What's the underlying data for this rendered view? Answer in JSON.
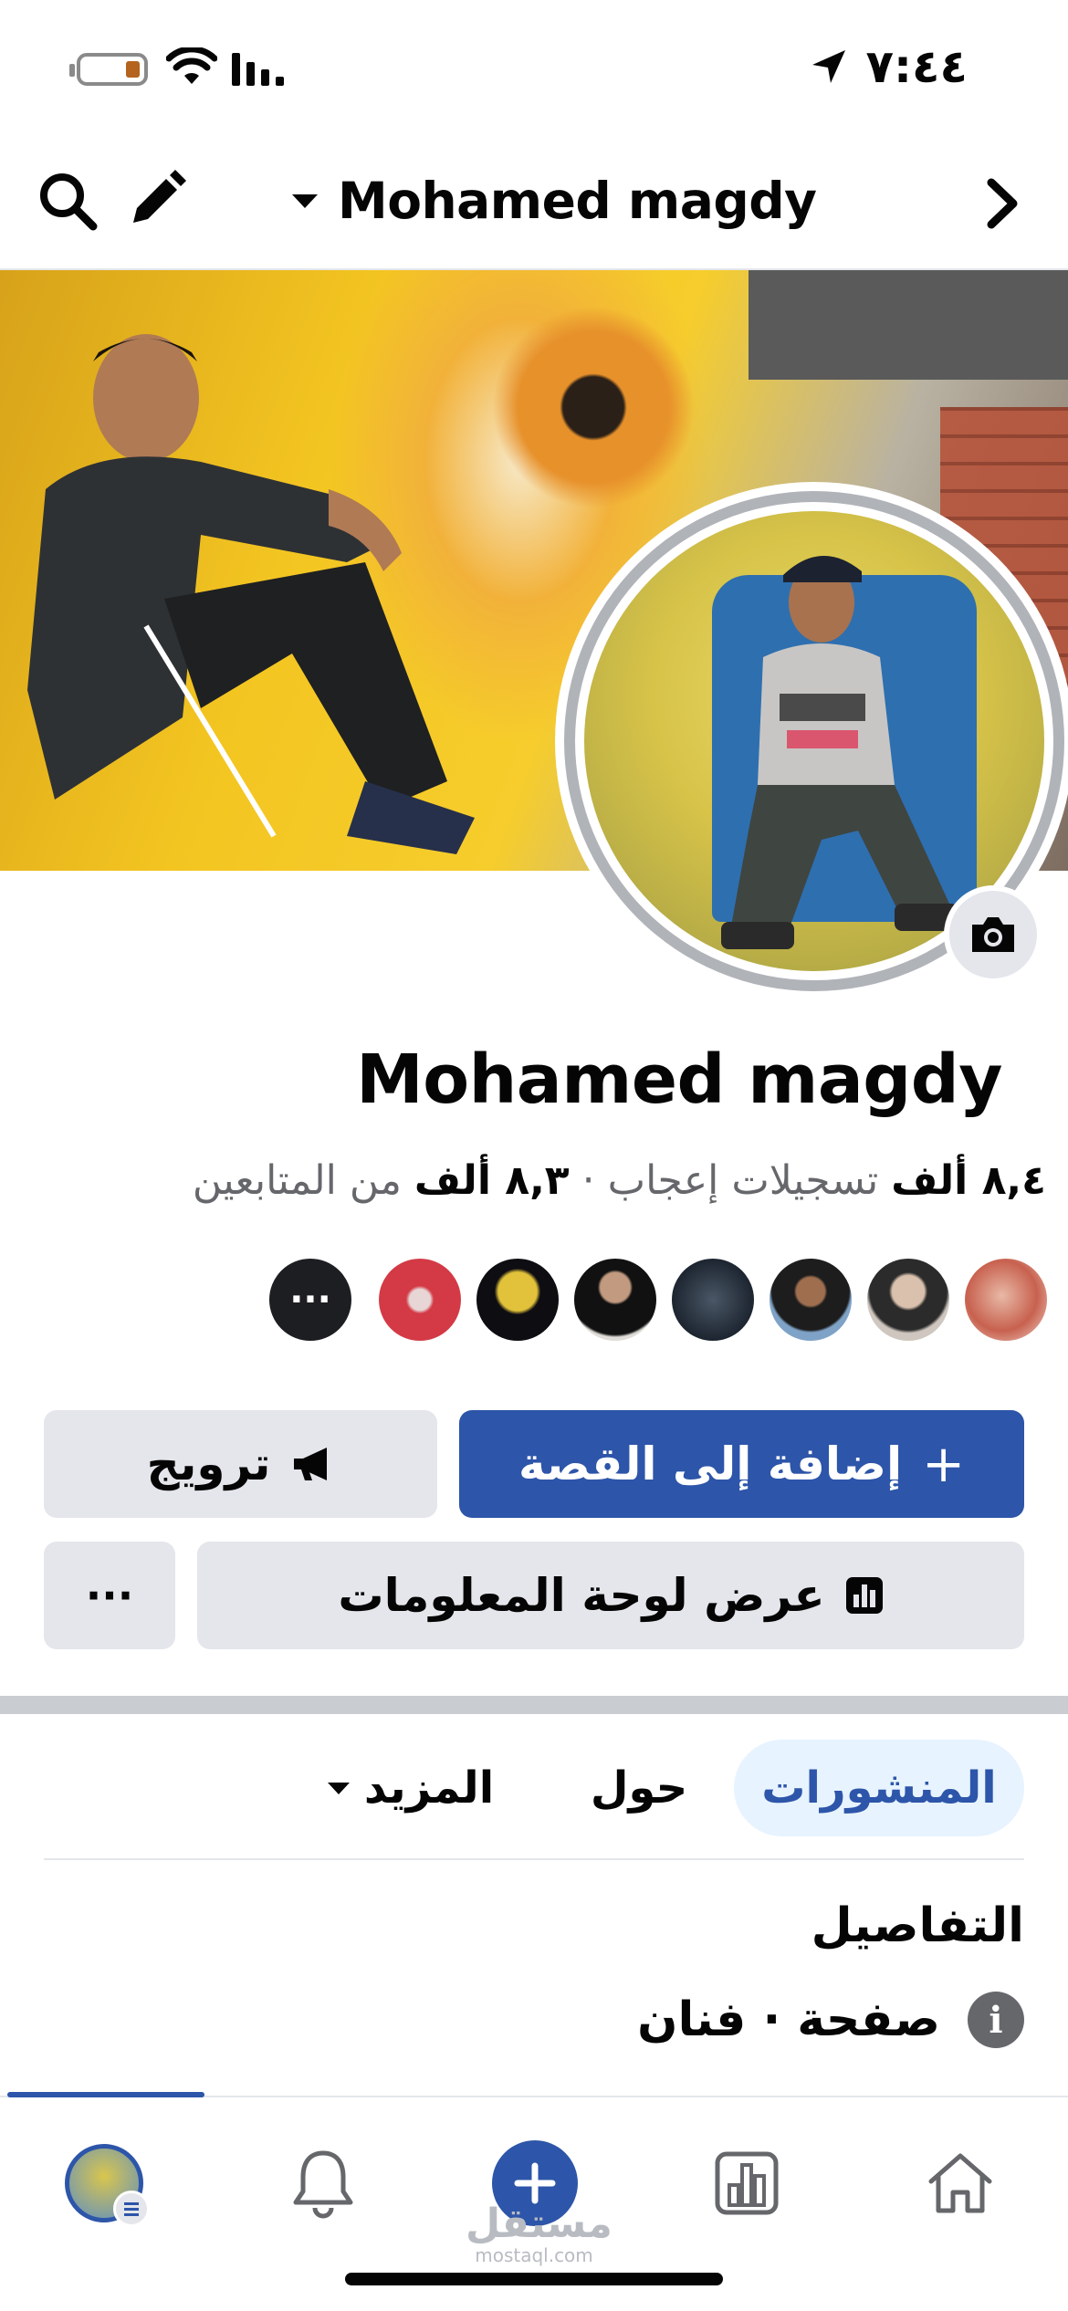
{
  "status_bar": {
    "time": "٧:٤٤",
    "battery_color": "#b4641e",
    "icons": [
      "battery-icon",
      "wifi-icon",
      "signal-icon",
      "location-arrow-icon"
    ]
  },
  "header": {
    "title": "Mohamed magdy",
    "icons": [
      "search-icon",
      "edit-pencil-icon",
      "chevron-down-icon",
      "chevron-right-icon"
    ]
  },
  "profile": {
    "name": "Mohamed magdy",
    "stats": {
      "likes_count": "٨,٤ ألف",
      "likes_label": "تسجيلات إعجاب",
      "separator": "·",
      "followers_count": "٨,٣ ألف",
      "followers_label": "من المتابعين"
    },
    "follower_avatar_count": 8,
    "more_faces_label": "···"
  },
  "actions": {
    "add_story": {
      "icon": "+",
      "label": "إضافة إلى القصة"
    },
    "promote": {
      "label": "ترويج",
      "icon": "megaphone-icon"
    },
    "dashboard": {
      "label": "عرض لوحة المعلومات",
      "icon": "bar-chart-icon"
    },
    "more": {
      "label": "···"
    }
  },
  "tabs": [
    {
      "label": "المنشورات",
      "active": true
    },
    {
      "label": "حول",
      "active": false
    },
    {
      "label": "المزيد",
      "active": false
    }
  ],
  "details": {
    "title": "التفاصيل",
    "info_icon": "i",
    "text": "صفحة · فنان"
  },
  "bottom_nav": {
    "items": [
      "profile-tab",
      "notifications-bell-icon",
      "create-plus-icon",
      "insights-chart-icon",
      "home-icon"
    ]
  },
  "watermark": {
    "arabic": "مستقل",
    "latin": "mostaql.com"
  },
  "colors": {
    "accent": "#2d55a9",
    "button_grey": "#e4e6eb",
    "tab_active_bg": "#e7f3ff",
    "secondary_text": "#65676b"
  }
}
